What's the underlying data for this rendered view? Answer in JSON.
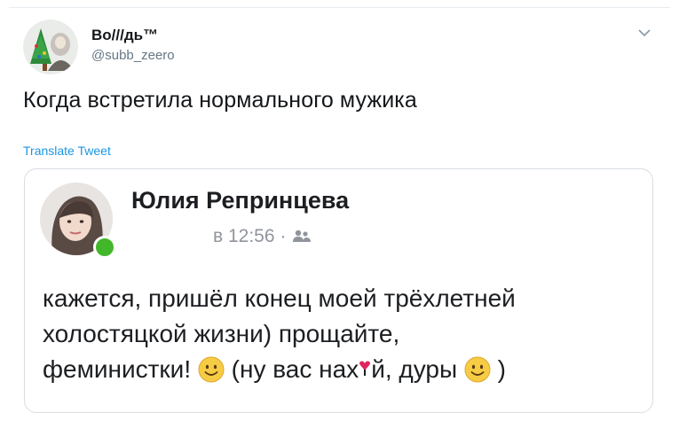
{
  "tweet": {
    "author": {
      "display_name": "Во///дь™",
      "handle": "@subb_zeero",
      "avatar_icon": "avatar-illustration"
    },
    "menu_icon": "chevron-down-icon",
    "text": "Когда встретила нормального мужика",
    "translate_label": "Translate Tweet"
  },
  "embedded_post": {
    "author_name": "Юлия Репринцева",
    "time": "в 12:56",
    "separator": "·",
    "audience_icon": "friends-icon",
    "status": "online",
    "text_lines": [
      "кажется, пришёл конец моей трёхлетней",
      "холостяцкой жизни) прощайте,",
      "феминистки!",
      "(ну вас нах",
      "й, дуры",
      ")"
    ],
    "emoji_icon": "smiley-icon",
    "heart_icon": "heart-icon"
  },
  "colors": {
    "link": "#1b95e0",
    "text": "#14171a",
    "muted": "#657786",
    "online": "#42b72a",
    "heart": "#e0245e"
  }
}
